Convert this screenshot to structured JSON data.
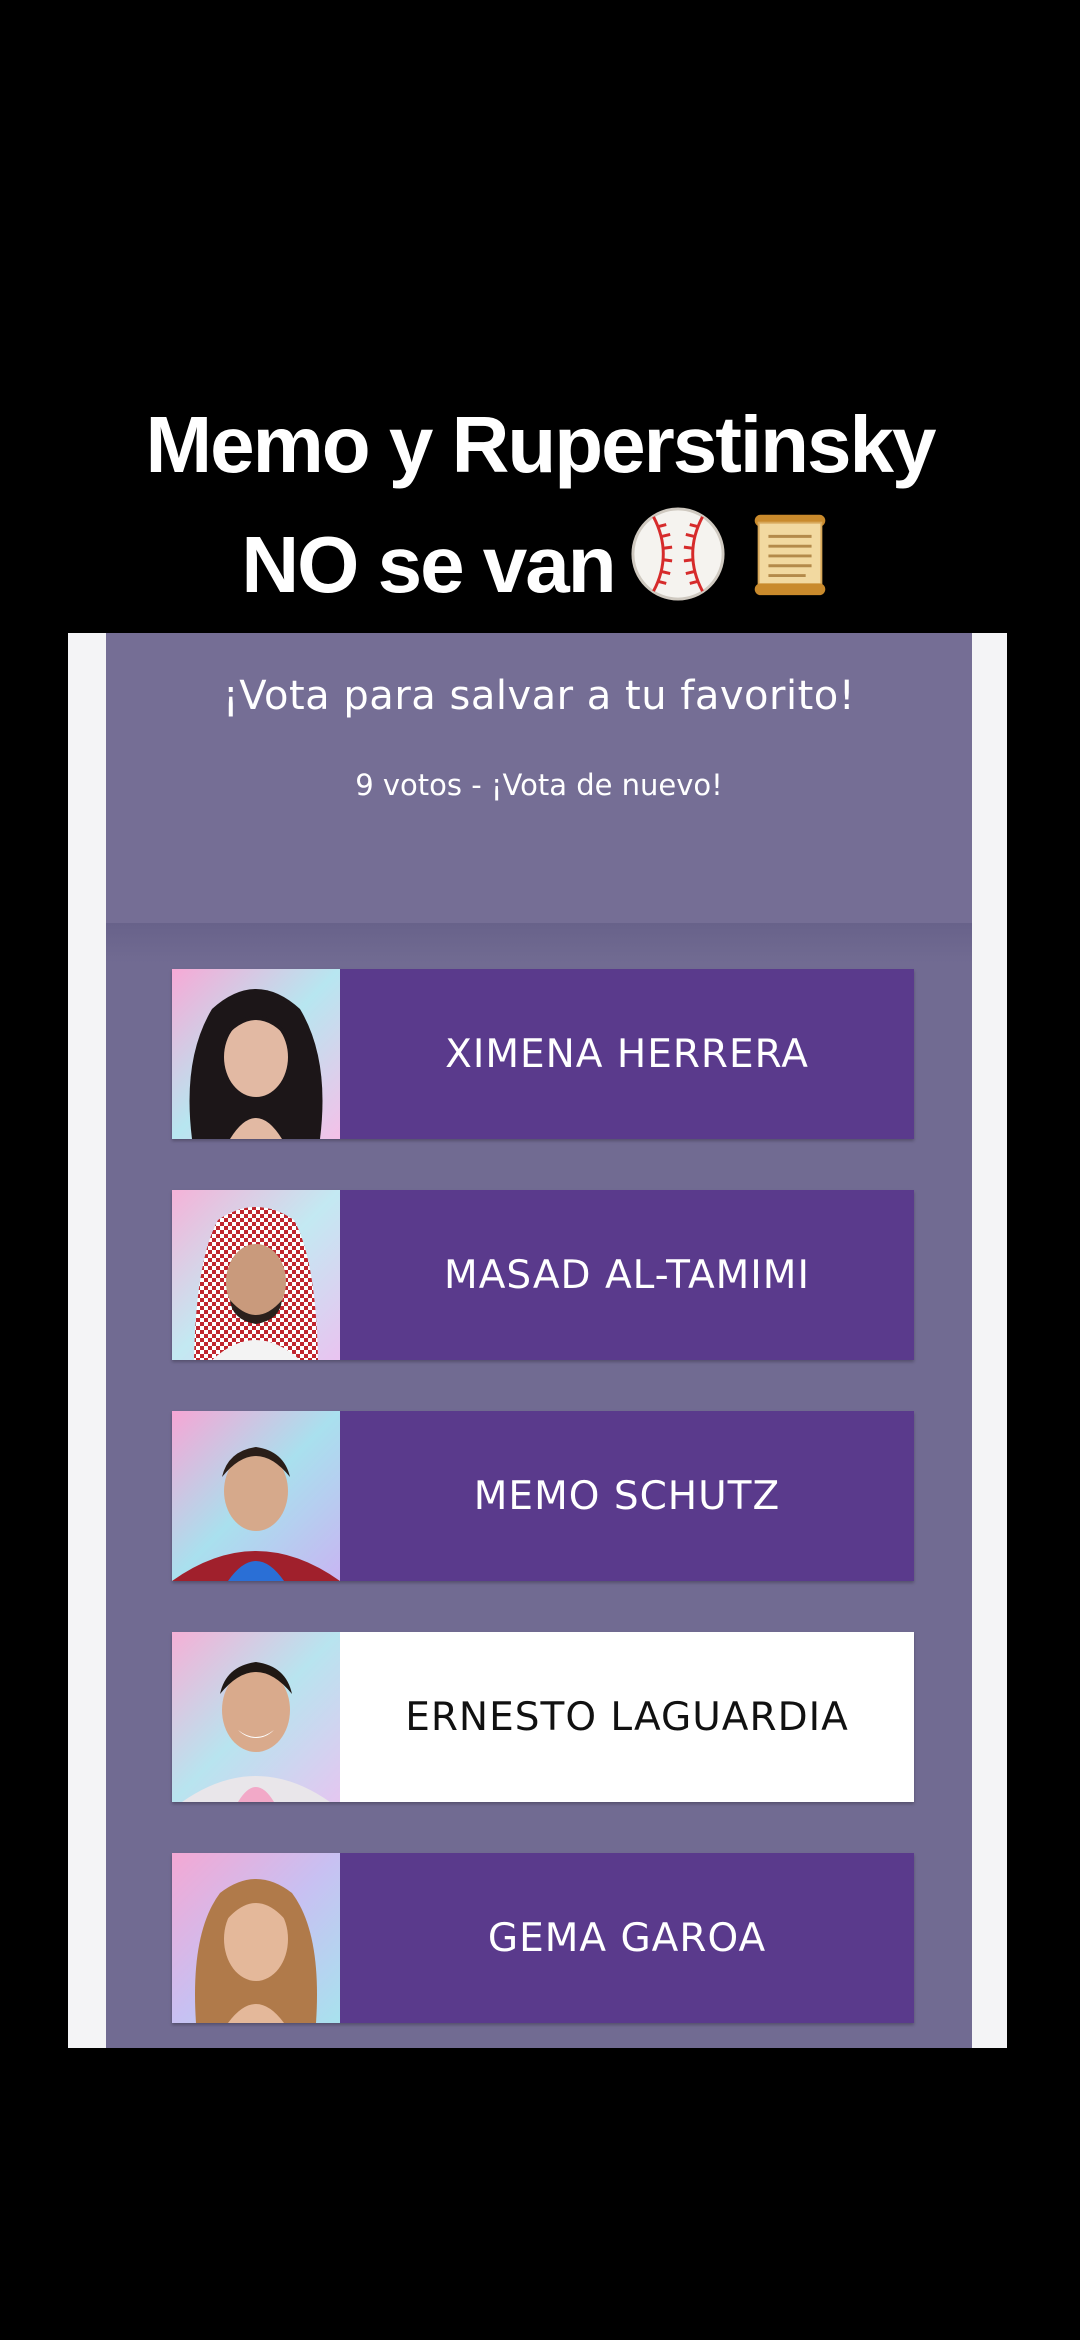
{
  "caption": {
    "line1": "Memo y Ruperstinsky",
    "line2": "NO se van",
    "emojis": [
      "baseball-icon",
      "scroll-icon"
    ]
  },
  "poll": {
    "title": "¡Vota para salvar a tu favorito!",
    "subtitle": "9 votos - ¡Vota de nuevo!",
    "candidates": [
      {
        "name": "XIMENA HERRERA",
        "selected": false
      },
      {
        "name": "MASAD AL-TAMIMI",
        "selected": false
      },
      {
        "name": "MEMO SCHUTZ",
        "selected": false
      },
      {
        "name": "ERNESTO LAGUARDIA",
        "selected": true
      },
      {
        "name": "GEMA GAROA",
        "selected": false
      }
    ]
  },
  "colors": {
    "background": "#000000",
    "panel": "#716b92",
    "button": "#5a3a8c",
    "button_selected": "#ffffff"
  }
}
